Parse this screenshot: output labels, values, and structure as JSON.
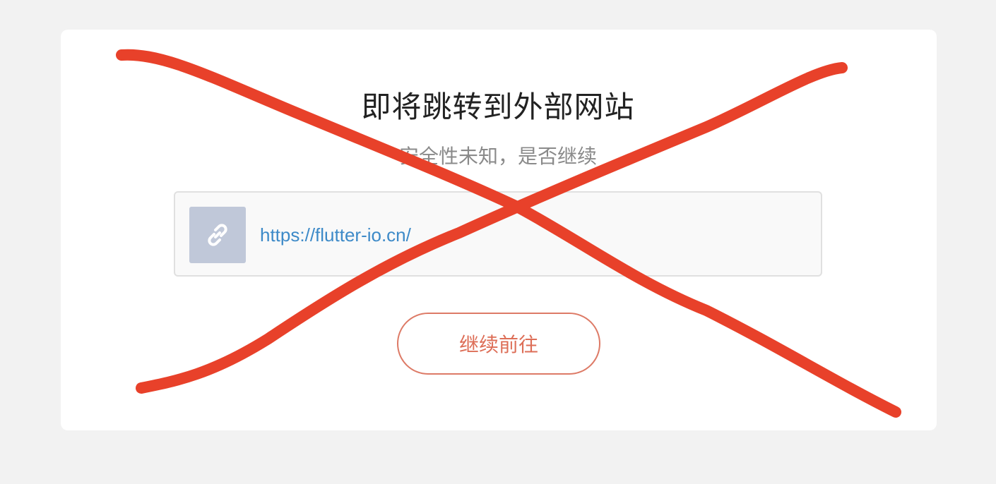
{
  "dialog": {
    "title": "即将跳转到外部网站",
    "subtitle": "安全性未知，是否继续",
    "link": {
      "url": "https://flutter-io.cn/",
      "icon": "link-icon"
    },
    "continue_label": "继续前往"
  },
  "overlay": {
    "mark": "x-cross",
    "color": "#e8412a"
  },
  "colors": {
    "background": "#f2f2f2",
    "card": "#ffffff",
    "title": "#222222",
    "subtitle": "#8a8a8a",
    "link": "#3d8ac8",
    "button_accent": "#dd6e57",
    "thumb": "#c0c8d9"
  }
}
